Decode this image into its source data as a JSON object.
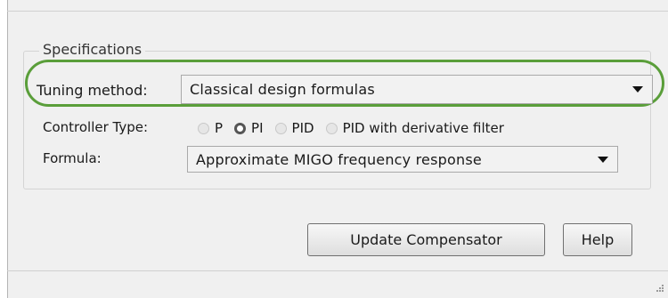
{
  "specifications": {
    "title": "Specifications",
    "tuning_method": {
      "label": "Tuning method:",
      "value": "Classical design formulas"
    },
    "controller_type": {
      "label": "Controller Type:",
      "options": [
        "P",
        "PI",
        "PID",
        "PID with derivative filter"
      ],
      "selected": "PI"
    },
    "formula": {
      "label": "Formula:",
      "value": "Approximate MIGO frequency response"
    }
  },
  "buttons": {
    "update": "Update Compensator",
    "help": "Help"
  },
  "colors": {
    "highlight": "#5a9e3a",
    "background": "#f0f0f0"
  }
}
